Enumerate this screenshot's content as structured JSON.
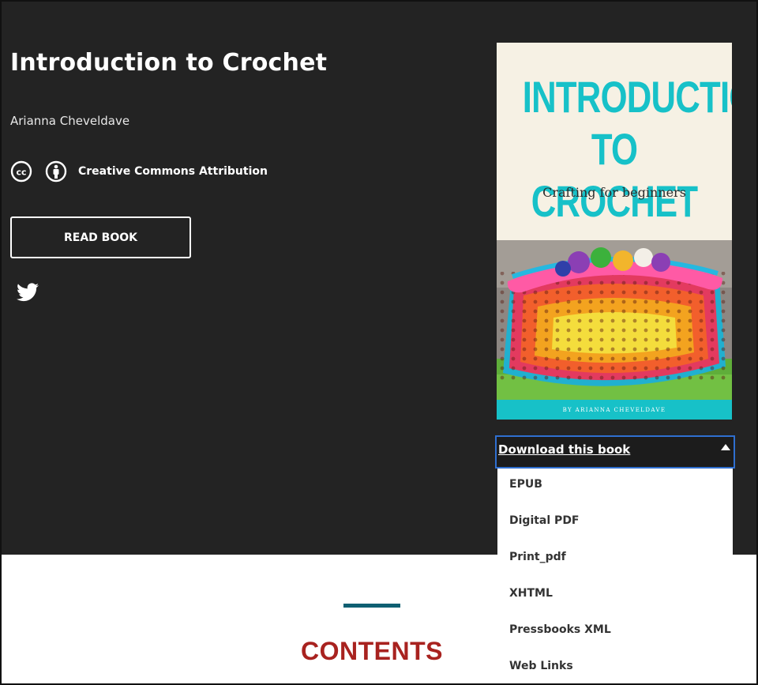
{
  "book": {
    "title": "Introduction to Crochet",
    "author": "Arianna Cheveldave",
    "license_label": "Creative Commons Attribution",
    "read_button": "READ BOOK"
  },
  "cover": {
    "title": "INTRODUCTION TO CROCHET",
    "subtitle": "Crafting for beginners",
    "byline": "BY ARIANNA CHEVELDAVE"
  },
  "download": {
    "toggle_label": "Download this book",
    "options": [
      "EPUB",
      "Digital PDF",
      "Print_pdf",
      "XHTML",
      "Pressbooks XML",
      "Web Links"
    ]
  },
  "contents": {
    "heading": "CONTENTS"
  },
  "colors": {
    "hero_bg": "#232323",
    "accent_teal": "#17c1c8",
    "heading_red": "#a8221f",
    "rule": "#0f5f72"
  },
  "icons": [
    "cc-icon",
    "attribution-icon",
    "twitter-icon",
    "caret-up-icon"
  ]
}
